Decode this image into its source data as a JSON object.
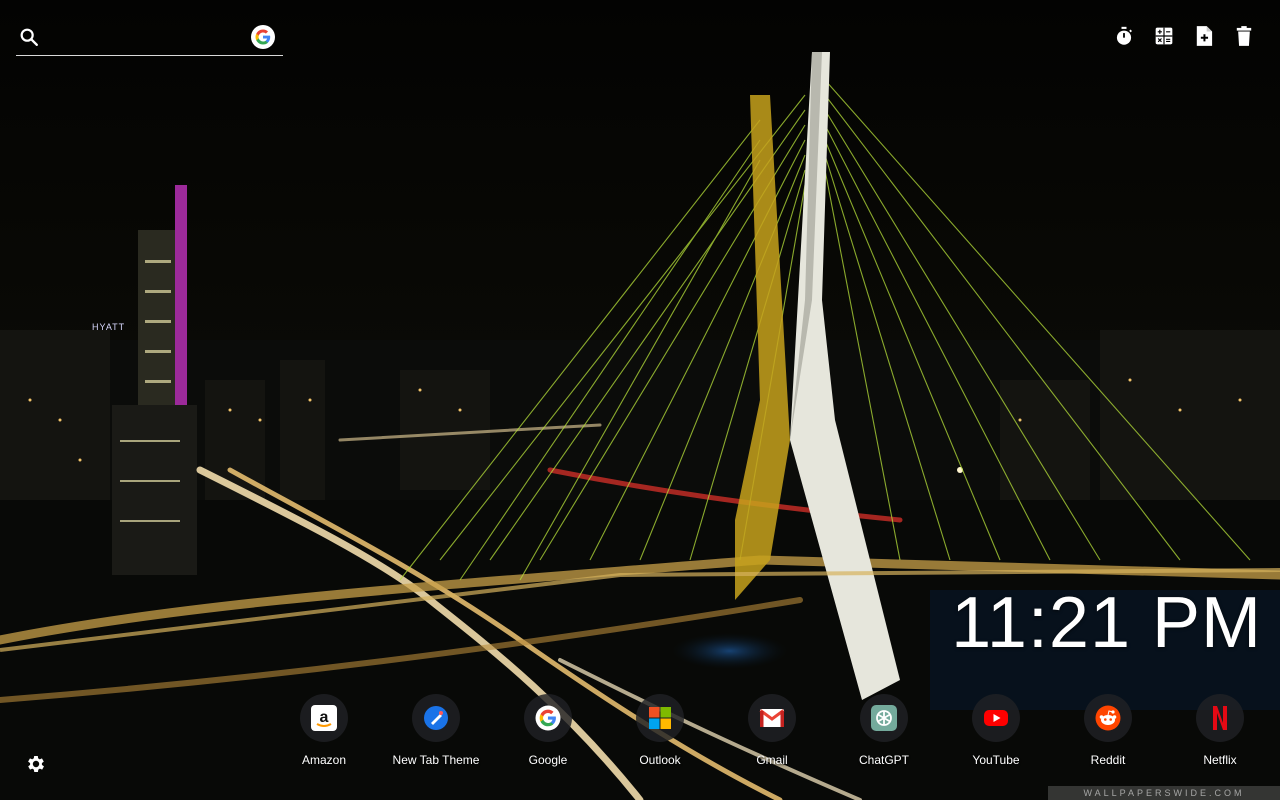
{
  "search": {
    "placeholder": "",
    "value": "",
    "search_icon": "search-icon",
    "engine_icon": "google-logo-icon"
  },
  "toolbar": {
    "icons": [
      "timer-icon",
      "calculator-icon",
      "add-note-icon",
      "trash-icon"
    ]
  },
  "clock": {
    "time": "11:21 PM"
  },
  "shortcuts": [
    {
      "label": "Amazon",
      "icon": "amazon-icon"
    },
    {
      "label": "New Tab Theme",
      "icon": "new-tab-theme-icon"
    },
    {
      "label": "Google",
      "icon": "google-icon"
    },
    {
      "label": "Outlook",
      "icon": "microsoft-icon"
    },
    {
      "label": "Gmail",
      "icon": "gmail-icon"
    },
    {
      "label": "ChatGPT",
      "icon": "chatgpt-icon"
    },
    {
      "label": "YouTube",
      "icon": "youtube-icon"
    },
    {
      "label": "Reddit",
      "icon": "reddit-icon"
    },
    {
      "label": "Netflix",
      "icon": "netflix-icon"
    }
  ],
  "settings": {
    "icon": "gear-icon"
  },
  "background": {
    "watermark": "WALLPAPERSWIDE.COM",
    "building_sign": "HYATT",
    "colors": {
      "sky": "#050503",
      "cables": "#b6e03a",
      "pylon": "#e9e9e0",
      "traffic": "#ffbf5a"
    }
  }
}
